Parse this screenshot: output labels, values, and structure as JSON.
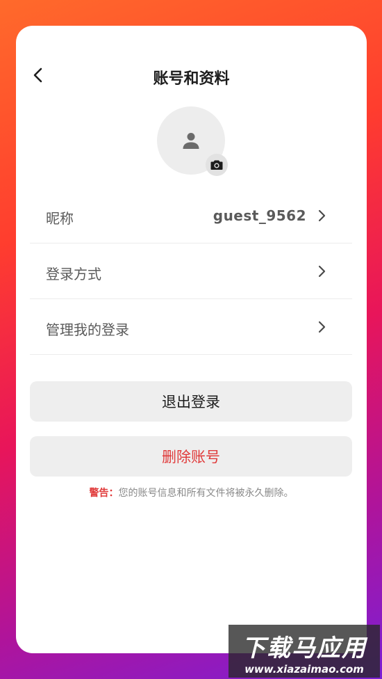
{
  "header": {
    "title": "账号和资料",
    "back_icon": "chevron-left-icon"
  },
  "avatar": {
    "icon": "person-icon",
    "camera_icon": "camera-icon"
  },
  "rows": [
    {
      "label": "昵称",
      "value": "guest_9562"
    },
    {
      "label": "登录方式",
      "value": ""
    },
    {
      "label": "管理我的登录",
      "value": ""
    }
  ],
  "buttons": {
    "logout": "退出登录",
    "delete": "删除账号"
  },
  "warning": {
    "prefix": "警告：",
    "text": "您的账号信息和所有文件将被永久删除。"
  },
  "watermark": {
    "main": "下载马应用",
    "sub": "www.xiazaimao.com"
  },
  "colors": {
    "danger": "#e03a3a",
    "row_text": "#5a5a5a",
    "button_bg": "#eeeeee"
  }
}
